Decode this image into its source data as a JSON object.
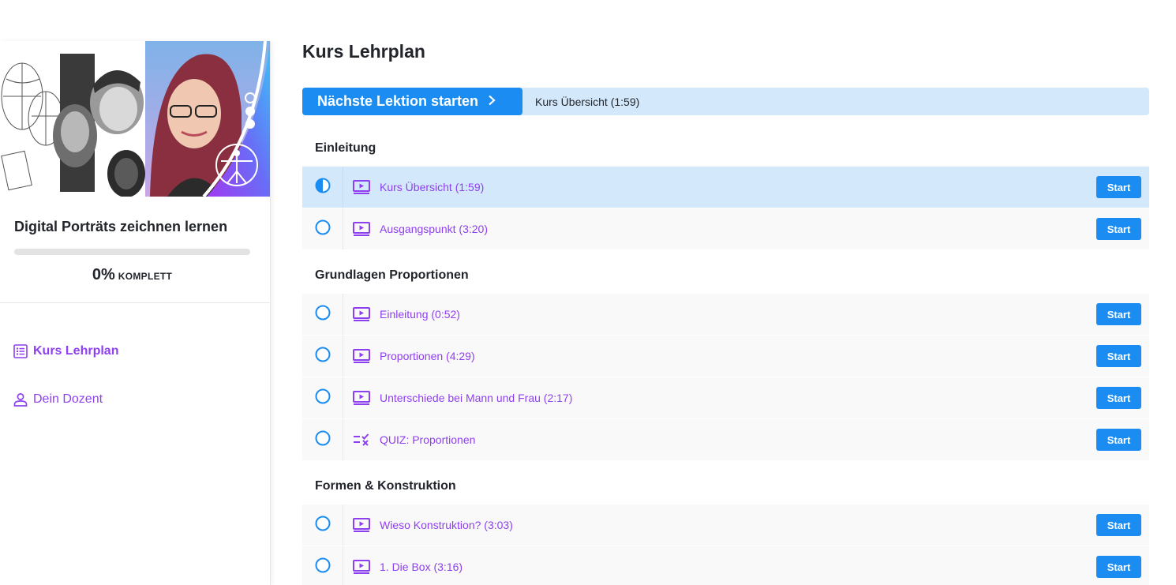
{
  "sidebar": {
    "course_title": "Digital Porträts zeichnen lernen",
    "progress": {
      "percent": 0,
      "percent_label": "0%",
      "complete_label": "KOMPLETT"
    },
    "nav": [
      {
        "label": "Kurs Lehrplan",
        "icon": "list-icon",
        "active": true
      },
      {
        "label": "Dein Dozent",
        "icon": "person-icon",
        "active": false
      }
    ]
  },
  "main": {
    "title": "Kurs Lehrplan",
    "next_button_label": "Nächste Lektion starten",
    "next_lesson": "Kurs Übersicht (1:59)",
    "start_label": "Start",
    "sections": [
      {
        "title": "Einleitung",
        "lessons": [
          {
            "name": "Kurs Übersicht (1:59)",
            "type": "video",
            "status": "in-progress"
          },
          {
            "name": "Ausgangspunkt (3:20)",
            "type": "video",
            "status": "not-started"
          }
        ]
      },
      {
        "title": "Grundlagen Proportionen",
        "lessons": [
          {
            "name": "Einleitung (0:52)",
            "type": "video",
            "status": "not-started"
          },
          {
            "name": "Proportionen (4:29)",
            "type": "video",
            "status": "not-started"
          },
          {
            "name": "Unterschiede bei Mann und Frau (2:17)",
            "type": "video",
            "status": "not-started"
          },
          {
            "name": "QUIZ: Proportionen",
            "type": "quiz",
            "status": "not-started"
          }
        ]
      },
      {
        "title": "Formen & Konstruktion",
        "lessons": [
          {
            "name": "Wieso Konstruktion? (3:03)",
            "type": "video",
            "status": "not-started"
          },
          {
            "name": "1. Die Box (3:16)",
            "type": "video",
            "status": "not-started"
          }
        ]
      }
    ]
  },
  "colors": {
    "accent_purple": "#8e3ff0",
    "primary_blue": "#1a8cf2",
    "highlight_blue": "#d4e8fb"
  }
}
